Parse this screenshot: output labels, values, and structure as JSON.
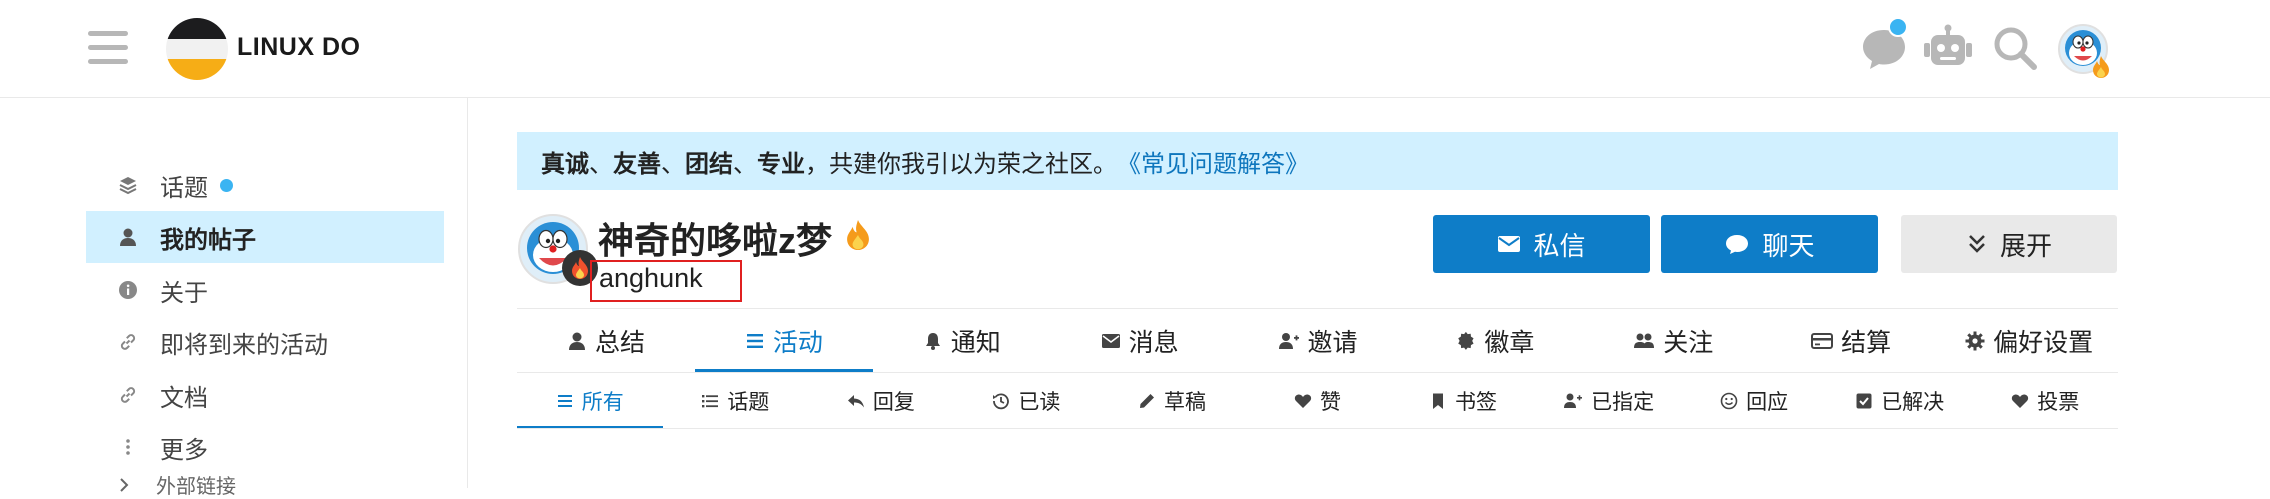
{
  "site": {
    "title": "LINUX DO"
  },
  "sidebar": {
    "items": [
      {
        "label": "话题",
        "icon": "layers-icon",
        "has_dot": true
      },
      {
        "label": "我的帖子",
        "icon": "user-icon",
        "active": true
      },
      {
        "label": "关于",
        "icon": "info-icon"
      },
      {
        "label": "即将到来的活动",
        "icon": "link-icon"
      },
      {
        "label": "文档",
        "icon": "link-icon"
      },
      {
        "label": "更多",
        "icon": "more-vertical-icon"
      }
    ],
    "section_label": "外部链接"
  },
  "banner": {
    "bold_words": [
      "真诚",
      "友善",
      "团结",
      "专业"
    ],
    "separator": "、",
    "rest": "，共建你我引以为荣之社区。",
    "link": "《常见问题解答》"
  },
  "profile": {
    "name": "神奇的哆啦z梦",
    "username": "anghunk"
  },
  "buttons": {
    "message": "私信",
    "chat": "聊天",
    "expand": "展开"
  },
  "tabs": [
    {
      "label": "总结",
      "icon": "user-icon"
    },
    {
      "label": "活动",
      "icon": "list-icon",
      "active": true
    },
    {
      "label": "通知",
      "icon": "bell-icon"
    },
    {
      "label": "消息",
      "icon": "envelope-icon"
    },
    {
      "label": "邀请",
      "icon": "user-plus-icon"
    },
    {
      "label": "徽章",
      "icon": "badge-icon"
    },
    {
      "label": "关注",
      "icon": "users-icon"
    },
    {
      "label": "结算",
      "icon": "credit-card-icon"
    },
    {
      "label": "偏好设置",
      "icon": "gear-icon"
    }
  ],
  "subtabs": [
    {
      "label": "所有",
      "icon": "list-icon",
      "active": true
    },
    {
      "label": "话题",
      "icon": "list-icon"
    },
    {
      "label": "回复",
      "icon": "reply-icon"
    },
    {
      "label": "已读",
      "icon": "history-icon"
    },
    {
      "label": "草稿",
      "icon": "pencil-icon"
    },
    {
      "label": "赞",
      "icon": "heart-icon"
    },
    {
      "label": "书签",
      "icon": "bookmark-icon"
    },
    {
      "label": "已指定",
      "icon": "user-plus-icon"
    },
    {
      "label": "回应",
      "icon": "smile-icon"
    },
    {
      "label": "已解决",
      "icon": "check-square-icon"
    },
    {
      "label": "投票",
      "icon": "heart-icon"
    }
  ],
  "colors": {
    "accent": "#0e7dc8",
    "highlight": "#d1f0ff",
    "dot": "#3ab4f2"
  }
}
